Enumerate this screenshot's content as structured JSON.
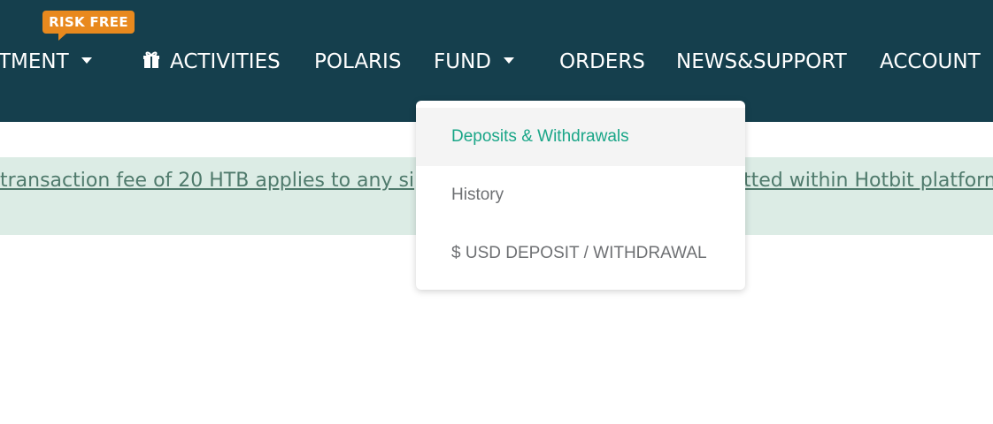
{
  "nav": {
    "items": [
      {
        "label": "TMENT",
        "has_caret": true
      },
      {
        "label": "ACTIVITIES",
        "icon": "gift-icon"
      },
      {
        "label": "POLARIS"
      },
      {
        "label": "FUND",
        "has_caret": true
      },
      {
        "label": "ORDERS"
      },
      {
        "label": "NEWS&SUPPORT"
      },
      {
        "label": "ACCOUNT"
      }
    ],
    "badge": "RISK FREE"
  },
  "notice": {
    "text_left": "transaction fee of 20 HTB applies to any si",
    "text_right": "tted within Hotbit platform"
  },
  "dropdown": {
    "items": [
      {
        "label": "Deposits & Withdrawals",
        "active": true
      },
      {
        "label": "History",
        "active": false
      },
      {
        "label": "$ USD DEPOSIT / WITHDRAWAL",
        "active": false
      }
    ]
  },
  "colors": {
    "navbar": "#153f4d",
    "badge": "#e8891e",
    "notice_bg": "#dcece5",
    "notice_text": "#4f7a6c",
    "dropdown_active_text": "#1aa688"
  }
}
